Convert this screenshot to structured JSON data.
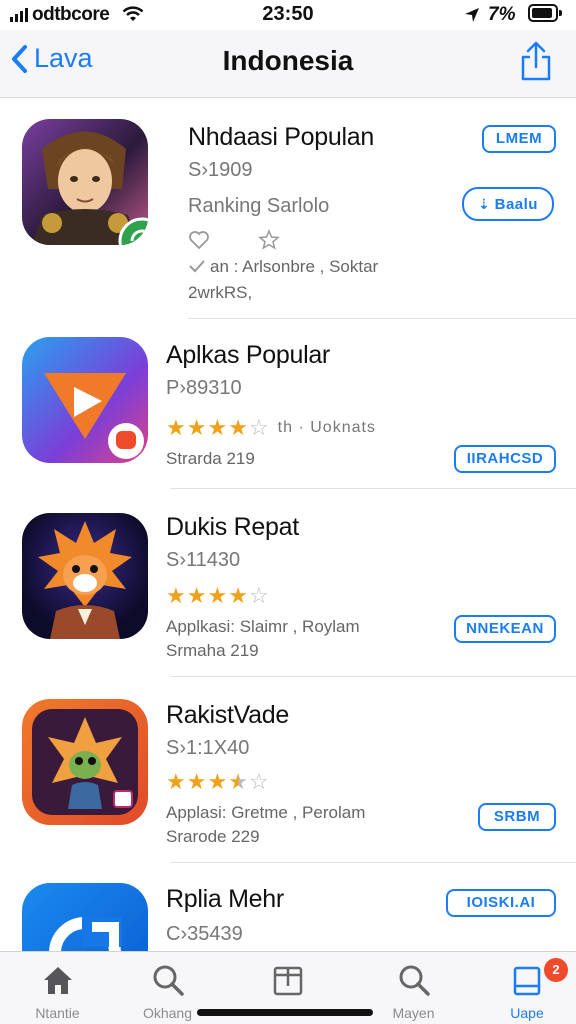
{
  "status": {
    "carrier": "odtbcore",
    "time": "23:50",
    "battery": "7%"
  },
  "nav": {
    "back_label": "Lava",
    "title": "Indonesia"
  },
  "apps": [
    {
      "name": "Nhdaasi Populan",
      "line1": "S›1909",
      "line2": "Ranking Sarlolo",
      "line3": "an : Arlsonbre , Soktar",
      "line4": "2wrkRS,",
      "button": "LMEM",
      "button2": "Baalu",
      "rating": null
    },
    {
      "name": "Aplkas Popular",
      "line1": "P›89310",
      "line2": "th · Uoknats",
      "line3": "Strarda 219",
      "button": "IIRAHCSD",
      "rating": 4
    },
    {
      "name": "Dukis Repat",
      "line1": "S›11430",
      "line2": "Applkasi: Slaimr , Roylam",
      "line3": "Srmaha 219",
      "button": "NNEKEAN",
      "rating": 4
    },
    {
      "name": "RakistVade",
      "line1": "S›1:1X40",
      "line2": "Applasi: Gretme , Perolam",
      "line3": "Srarode 229",
      "button": "SRBM",
      "rating": 3.5
    },
    {
      "name": "Rplia Mehr",
      "line1": "C›35439",
      "button": "IOISKI.AI",
      "rating": null
    }
  ],
  "tabs": [
    {
      "label": "Ntantie",
      "icon": "home-icon"
    },
    {
      "label": "Okhang",
      "icon": "search-icon"
    },
    {
      "label": "",
      "icon": "box-icon"
    },
    {
      "label": "Mayen",
      "icon": "search-icon"
    },
    {
      "label": "Uape",
      "icon": "updates-icon",
      "badge": "2"
    }
  ],
  "colors": {
    "accent": "#1a7df5",
    "star": "#f0a21a",
    "badge": "#ef4a2a"
  }
}
